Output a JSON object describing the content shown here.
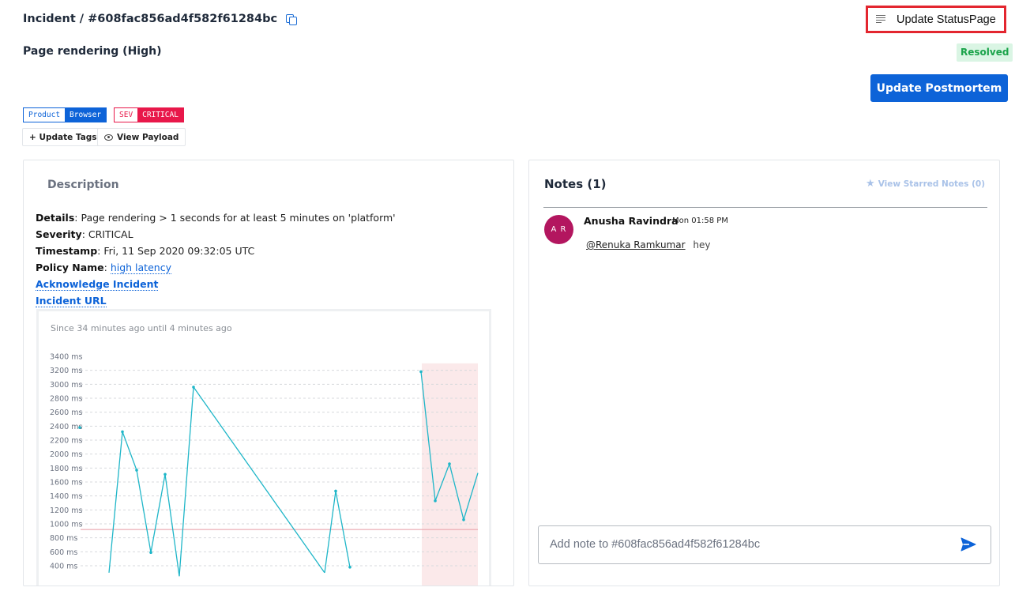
{
  "header": {
    "breadcrumb": "Incident / #608fac856ad4f582f61284bc",
    "update_statuspage_label": "Update StatusPage",
    "incident_title": "Page rendering (High)",
    "status_badge": "Resolved",
    "update_postmortem_label": "Update Postmortem"
  },
  "tags": [
    {
      "key": "Product",
      "value": "Browser",
      "color": "#0d63d8"
    },
    {
      "key": "SEV",
      "value": "CRITICAL",
      "color": "#e8184a"
    }
  ],
  "actions": {
    "update_tags_label": "+ Update Tags",
    "view_payload_label": "View Payload"
  },
  "description": {
    "heading": "Description",
    "details_label": "Details",
    "details_value": ": Page rendering > 1 seconds for at least 5 minutes on 'platform'",
    "severity_label": "Severity",
    "severity_value": ": CRITICAL",
    "timestamp_label": "Timestamp",
    "timestamp_value": ": Fri, 11 Sep 2020 09:32:05 UTC",
    "policy_label": "Policy Name",
    "policy_sep": ": ",
    "policy_link": "high latency",
    "acknowledge_link": "Acknowledge Incident",
    "incident_url_link": "Incident URL"
  },
  "chart_data": {
    "type": "line",
    "subtitle": "Since 34 minutes ago until 4 minutes ago",
    "y_ticks": [
      "3400 ms",
      "3200 ms",
      "3000 ms",
      "2800 ms",
      "2600 ms",
      "2400 ms",
      "2200 ms",
      "2000 ms",
      "1800 ms",
      "1600 ms",
      "1400 ms",
      "1200 ms",
      "1000 ms",
      "800 ms",
      "600 ms",
      "400 ms"
    ],
    "ylim": [
      400,
      3400
    ],
    "threshold": 920,
    "series": [
      {
        "values": [
          {
            "x": 0,
            "y": 2380
          },
          {
            "x": 1,
            "y": 300
          },
          {
            "x": 2,
            "y": 2320
          },
          {
            "x": 3,
            "y": 1770
          },
          {
            "x": 4,
            "y": 590
          },
          {
            "x": 5,
            "y": 1710
          },
          {
            "x": 6,
            "y": 250
          },
          {
            "x": 7,
            "y": 2960
          },
          {
            "x": 8,
            "y": 300
          },
          {
            "x": 9,
            "y": 1470
          },
          {
            "x": 10,
            "y": 380
          },
          {
            "x": 11,
            "y": 3180
          },
          {
            "x": 12,
            "y": 1330
          },
          {
            "x": 13,
            "y": 1860
          },
          {
            "x": 14,
            "y": 1060
          },
          {
            "x": 15,
            "y": 1730
          }
        ]
      }
    ],
    "colors": {
      "line": "#1fb6c8",
      "threshold": "#e89aa3",
      "highlight": "#fbe9ea"
    },
    "grid": true
  },
  "notes": {
    "title": "Notes (1)",
    "starred_label": "View Starred Notes (0)",
    "items": [
      {
        "initials": "A R",
        "author": "Anusha Ravindra",
        "time": "Mon 01:58 PM",
        "mention": "@Renuka Ramkumar",
        "text": "hey"
      }
    ],
    "input_placeholder": "Add note to #608fac856ad4f582f61284bc"
  },
  "colors": {
    "accent": "#0d63d8",
    "critical": "#e8184a",
    "resolved_text": "#1aa34a",
    "resolved_bg": "#daf5e4",
    "avatar": "#b3165f"
  }
}
